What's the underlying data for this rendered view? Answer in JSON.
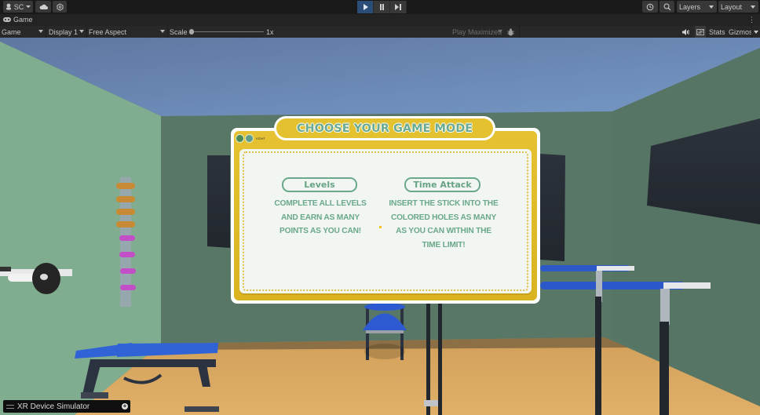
{
  "editor": {
    "account_label": "SC",
    "play_controls": [
      "play",
      "pause",
      "step"
    ],
    "layers_label": "Layers",
    "layout_label": "Layout"
  },
  "game_tab": {
    "title": "Game"
  },
  "game_toolbar": {
    "view_dropdown": "Game",
    "display_dropdown": "Display 1",
    "aspect_dropdown": "Free Aspect",
    "scale_label": "Scale",
    "scale_value": "1x",
    "play_mode_dropdown": "Play Maximized",
    "stats_label": "Stats",
    "gizmos_label": "Gizmos"
  },
  "menu_panel": {
    "title": "CHOOSE YOUR GAME MODE",
    "logo_caption": "ISDHT",
    "modes": [
      {
        "label": "Levels",
        "description_lines": [
          "COMPLETE ALL LEVELS",
          "AND EARN AS MANY",
          "POINTS AS YOU CAN!"
        ]
      },
      {
        "label": "Time Attack",
        "description_lines": [
          "INSERT THE STICK INTO THE",
          "COLORED HOLES AS MANY",
          "AS YOU CAN WITHIN THE",
          "TIME LIMIT!"
        ]
      }
    ]
  },
  "xr_simulator": {
    "label": "XR Device Simulator"
  },
  "colors": {
    "panel_yellow": "#e3c12f",
    "panel_text_green": "#6aa88a",
    "play_active": "#2a4e78",
    "wall_green": "#587767",
    "ceiling_blue": "#6882ae"
  }
}
